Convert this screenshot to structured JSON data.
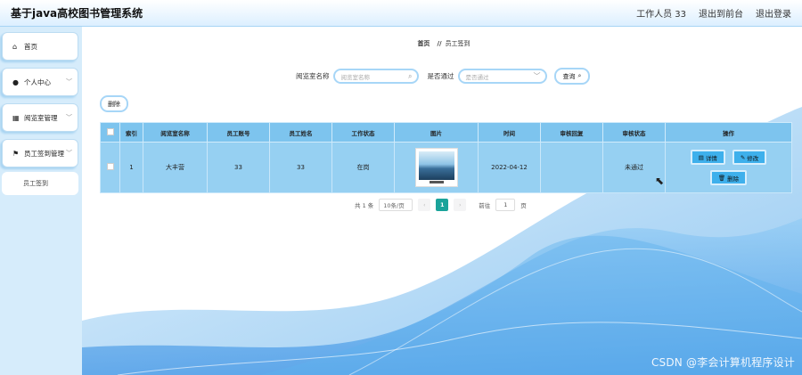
{
  "app": {
    "title": "基于java高校图书管理系统"
  },
  "header": {
    "user": "工作人员 33",
    "front": "退出到前台",
    "logout": "退出登录"
  },
  "sidebar": {
    "items": [
      {
        "label": "首页",
        "icon": "home-icon"
      },
      {
        "label": "个人中心",
        "icon": "user-icon"
      },
      {
        "label": "阅览室管理",
        "icon": "grid-icon"
      },
      {
        "label": "员工签到管理",
        "icon": "flag-icon"
      }
    ],
    "sub": {
      "label": "员工签到"
    }
  },
  "breadcrumb": {
    "home": "首页",
    "sep": "//",
    "current": "员工签到"
  },
  "search": {
    "room_label": "阅览室名称",
    "room_placeholder": "阅览室名称",
    "pass_label": "是否通过",
    "pass_placeholder": "是否通过",
    "query": "查询"
  },
  "toolbar": {
    "delete": "删除"
  },
  "table": {
    "headers": [
      "索引",
      "阅览室名称",
      "员工账号",
      "员工姓名",
      "工作状态",
      "图片",
      "时间",
      "审核回复",
      "审核状态",
      "操作"
    ],
    "rows": [
      {
        "index": "1",
        "room": "大丰营",
        "account": "33",
        "name": "33",
        "status": "在岗",
        "time": "2022-04-12",
        "reply": "",
        "review": "未通过"
      }
    ],
    "ops": {
      "detail": "详情",
      "edit": "修改",
      "delete": "删除"
    }
  },
  "pagination": {
    "total": "共 1 条",
    "size": "10条/页",
    "current": "1",
    "goto": "前往",
    "goto_value": "1",
    "page": "页"
  },
  "watermark": "CSDN @李会计算机程序设计",
  "colors": {
    "header_th": "#7dc4ee",
    "row_bg": "#96d0f2",
    "accent": "#3eb0ec",
    "page_active": "#1aa39a"
  }
}
